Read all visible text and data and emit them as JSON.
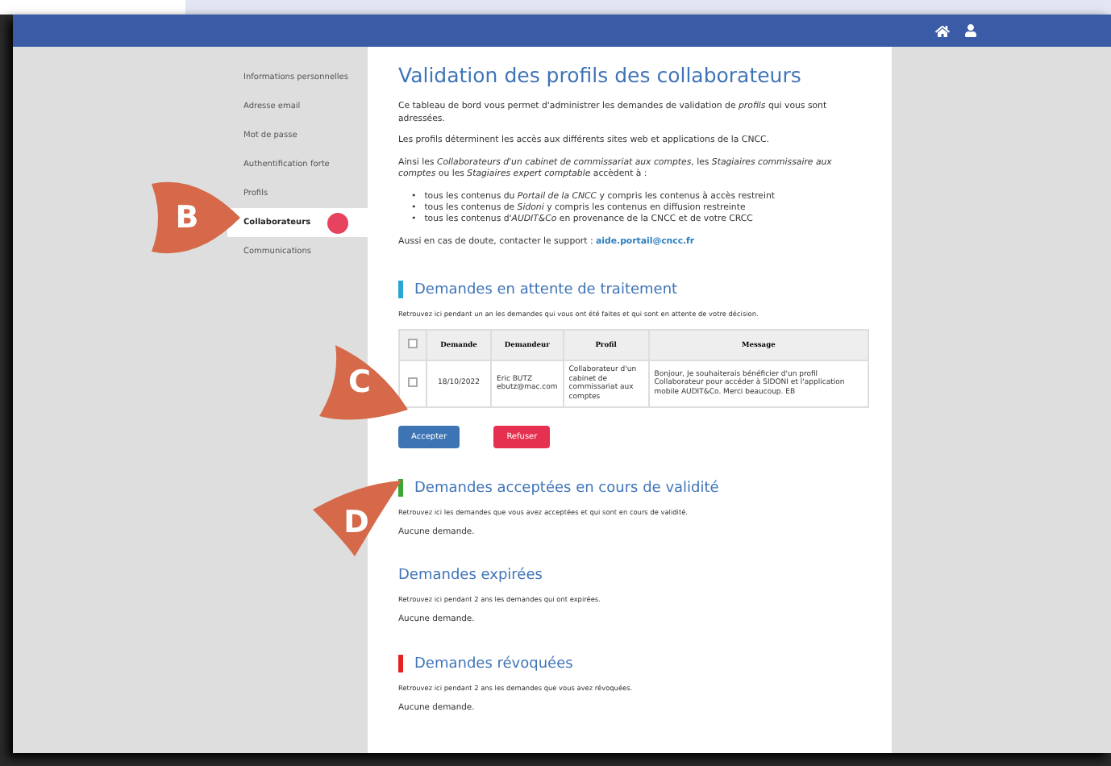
{
  "sidebar": {
    "items": [
      {
        "label": "Informations personnelles",
        "selected": false,
        "marked": false
      },
      {
        "label": "Adresse email",
        "selected": false,
        "marked": false
      },
      {
        "label": "Mot de passe",
        "selected": false,
        "marked": false
      },
      {
        "label": "Authentification forte",
        "selected": false,
        "marked": false
      },
      {
        "label": "Profils",
        "selected": false,
        "marked": false
      },
      {
        "label": "Collaborateurs",
        "selected": true,
        "marked": true
      },
      {
        "label": "Communications",
        "selected": false,
        "marked": false
      }
    ]
  },
  "page": {
    "title": "Validation des profils des collaborateurs",
    "intro": [
      "Ce tableau de bord vous permet d'administrer les demandes de validation de *profils* qui vous sont adressées.",
      "Les profils déterminent les accès aux différents sites web et applications de la CNCC.",
      "Ainsi les *Collaborateurs d'un cabinet de commissariat aux comptes*, les *Stagiaires commissaire aux comptes* ou les *Stagiaires expert comptable* accèdent à :"
    ],
    "bullets": [
      {
        "marker": "•",
        "text": "tous les contenus du *Portail de la CNCC* y compris les contenus à accès restreint"
      },
      {
        "marker": "•",
        "text": "tous les contenus de *Sidoni* y compris les contenus en diffusion restreinte"
      },
      {
        "marker": "•",
        "text": "tous les contenus d'*AUDIT&Co* en provenance de la CNCC et de votre CRCC"
      }
    ],
    "support": {
      "text": "Aussi en cas de doute, contacter le support :",
      "link": "aide.portail@cncc.fr"
    }
  },
  "sections": [
    {
      "title": "Demandes en attente de traitement",
      "color": "#2aa6d6",
      "description": "Retrouvez ici pendant un an les demandes qui vous ont été faites et qui sont en attente de votre décision.",
      "table": {
        "columns": [
          "Demande",
          "Demandeur",
          "Profil",
          "Message"
        ],
        "header_checked": false,
        "rows": [
          {
            "checked": false,
            "cells": [
              "18/10/2022",
              "Eric BUTZ\nebutz@mac.com",
              "Collaborateur d'un cabinet de commissariat aux comptes",
              "Bonjour, Je souhaiterais bénéficier d'un profil Collaborateur pour accéder à SIDONI et l'application mobile AUDIT&Co. Merci beaucoup. EB"
            ]
          }
        ]
      },
      "buttons": [
        {
          "label": "Accepter",
          "kind": "primary"
        },
        {
          "label": "Refuser",
          "kind": "danger"
        }
      ]
    },
    {
      "title": "Demandes acceptées en cours de validité",
      "color": "#3aa634",
      "description": "Retrouvez ici les demandes que vous avez acceptées et qui sont en cours de validité.",
      "empty": "Aucune demande."
    },
    {
      "title": "Demandes expirées",
      "description": "Retrouvez ici pendant 2 ans les demandes qui ont expirées.",
      "empty": "Aucune demande."
    },
    {
      "title": "Demandes révoquées",
      "color": "#e52222",
      "description": "Retrouvez ici pendant 2 ans les demandes que vous avez révoquées.",
      "empty": "Aucune demande."
    }
  ],
  "callouts": [
    {
      "label": "B"
    },
    {
      "label": "C"
    },
    {
      "label": "D"
    }
  ]
}
